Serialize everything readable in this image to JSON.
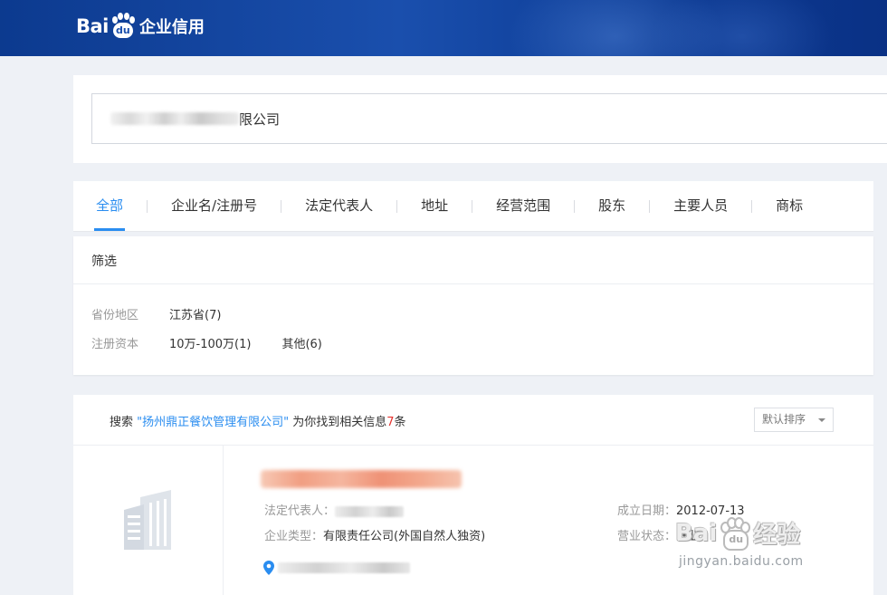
{
  "header": {
    "logo_prefix": "Bai",
    "logo_paw_text": "du",
    "logo_product": "企业信用"
  },
  "search": {
    "value_visible": "限公司"
  },
  "tabs": [
    {
      "label": "全部",
      "active": true
    },
    {
      "label": "企业名/注册号",
      "active": false
    },
    {
      "label": "法定代表人",
      "active": false
    },
    {
      "label": "地址",
      "active": false
    },
    {
      "label": "经营范围",
      "active": false
    },
    {
      "label": "股东",
      "active": false
    },
    {
      "label": "主要人员",
      "active": false
    },
    {
      "label": "商标",
      "active": false
    }
  ],
  "filter": {
    "title": "筛选",
    "region_label": "省份地区",
    "region_options": [
      "江苏省(7)"
    ],
    "capital_label": "注册资本",
    "capital_options": [
      "10万-100万(1)",
      "其他(6)"
    ]
  },
  "results": {
    "summary_prefix": "搜索 ",
    "keyword": "\"扬州鼎正餐饮管理有限公司\"",
    "summary_mid": " 为你找到相关信息",
    "count": "7",
    "summary_suffix": "条",
    "sort_label": "默认排序",
    "item": {
      "legal_rep_label": "法定代表人：",
      "company_type_label": "企业类型：",
      "company_type_value": "有限责任公司(外国自然人独资)",
      "founded_label": "成立日期：",
      "founded_value": "2012-07-13",
      "status_label": "营业状态：",
      "status_value": "开业"
    }
  },
  "watermark": {
    "brand": "Bai",
    "paw_text": "du",
    "product": "经验",
    "url": "jingyan.baidu.com"
  },
  "colors": {
    "header_bg": "#0c3a8f",
    "accent": "#2a8df0",
    "count_red": "#e5322e",
    "page_bg": "#eef1f6"
  }
}
